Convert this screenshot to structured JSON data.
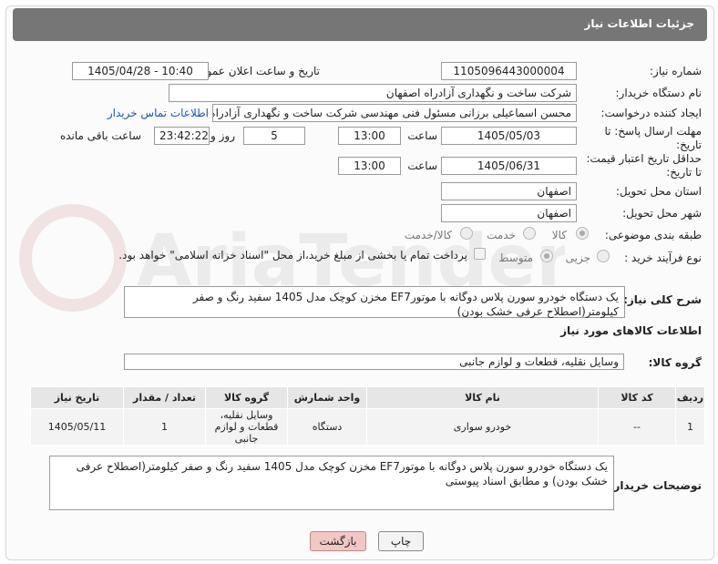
{
  "page": {
    "title": "جزئیات اطلاعات نیاز"
  },
  "fields": {
    "need_number_label": "شماره نیاز:",
    "need_number": "1105096443000004",
    "announce_label": "تاریخ و ساعت اعلان عمومی:",
    "announce_value": "1405/04/28 - 10:40",
    "buyer_org_label": "نام دستگاه خریدار:",
    "buyer_org": "شرکت ساخت و نگهداری آزادراه اصفهان",
    "creator_label": "ایجاد کننده درخواست:",
    "creator": "محسن اسماعیلی برزانی مسئول فنی مهندسی شرکت ساخت و نگهداری آزادراه اصفهان",
    "contact_link": "اطلاعات تماس خریدار",
    "reply_deadline_label_1": "مهلت ارسال پاسخ: تا",
    "reply_deadline_label_2": "تاریخ:",
    "reply_date": "1405/05/03",
    "time_label": "ساعت",
    "reply_time": "13:00",
    "reply_days": "5",
    "days_label": "روز و",
    "remaining_time": "23:42:22",
    "remaining_label": "ساعت باقی مانده",
    "price_deadline_label_1": "حداقل تاریخ اعتبار قیمت:",
    "price_deadline_label_2": "تا تاریخ:",
    "price_date": "1405/06/31",
    "price_time": "13:00",
    "province_label": "استان محل تحویل:",
    "province": "اصفهان",
    "city_label": "شهر محل تحویل:",
    "city": "اصفهان",
    "category_label": "طبقه بندی موضوعی:",
    "category_options": [
      "کالا",
      "خدمت",
      "کالا/خدمت"
    ],
    "process_label": "نوع فرآیند خرید :",
    "process_options": [
      "جزیی",
      "متوسط"
    ],
    "payment_note": "پرداخت تمام یا بخشی از مبلغ خرید،از محل \"اسناد خزانه اسلامی\" خواهد بود."
  },
  "summary": {
    "label": "شرح کلی نیاز:",
    "text": "یک دستگاه خودرو سورن پلاس دوگانه با موتورEF7  مخزن کوچک مدل 1405 سفید رنگ و صفر کیلومتر(اصطلاح عرفی خشک بودن)"
  },
  "goods": {
    "section_title": "اطلاعات کالاهای مورد نیاز",
    "group_label": "گروه کالا:",
    "group_value": "وسایل نقلیه، قطعات و لوازم جانبی",
    "columns": [
      "ردیف",
      "کد کالا",
      "نام کالا",
      "واحد شمارش",
      "گروه کالا",
      "تعداد / مقدار",
      "تاریخ نیاز"
    ],
    "rows": [
      {
        "row": "1",
        "code": "--",
        "name": "خودرو سواری",
        "unit": "دستگاه",
        "group": "وسایل نقلیه، قطعات و لوازم جانبی",
        "qty": "1",
        "date": "1405/05/11"
      }
    ]
  },
  "buyer_notes": {
    "label": "توضیحات خریدار:",
    "text": "یک دستگاه خودرو سورن پلاس دوگانه با موتورEF7  مخزن کوچک مدل 1405 سفید رنگ و صفر کیلومتر(اصطلاح عرفی خشک بودن) و مطابق اسناد پیوستی"
  },
  "buttons": {
    "print": "چاپ",
    "back": "بازگشت"
  },
  "watermark": "AriaTender.neT"
}
